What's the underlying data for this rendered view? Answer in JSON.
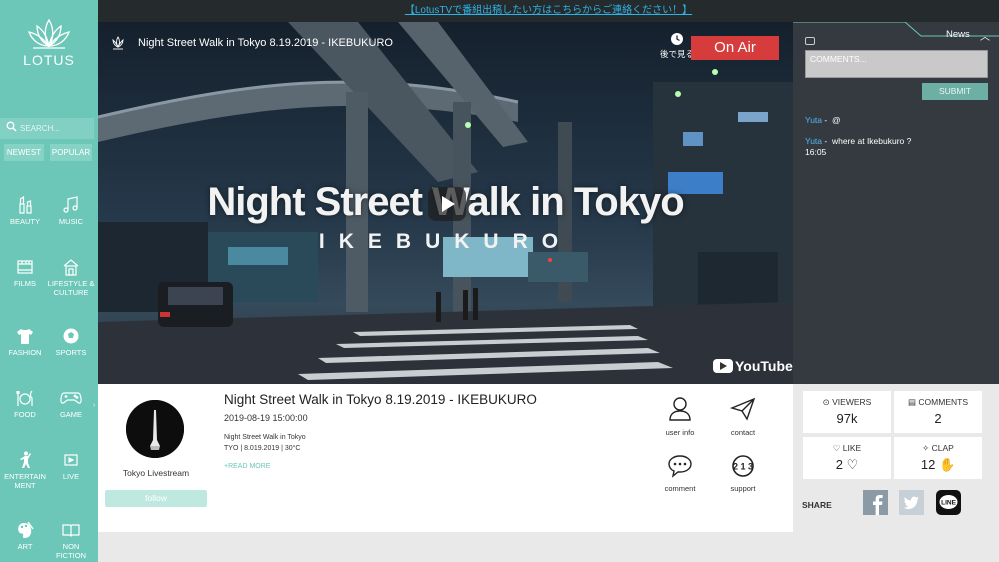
{
  "brand": {
    "name": "LOTUS"
  },
  "sidebar": {
    "search_placeholder": "SEARCH...",
    "sort": {
      "newest": "NEWEST",
      "popular": "POPULAR"
    },
    "categories": [
      {
        "label": "BEAUTY",
        "icon": "lipstick-icon"
      },
      {
        "label": "MUSIC",
        "icon": "music-note-icon"
      },
      {
        "label": "FILMS",
        "icon": "film-icon"
      },
      {
        "label": "LIFESTYLE & CULTURE",
        "icon": "house-icon"
      },
      {
        "label": "FASHION",
        "icon": "shirt-icon"
      },
      {
        "label": "SPORTS",
        "icon": "soccer-ball-icon"
      },
      {
        "label": "FOOD",
        "icon": "utensils-icon"
      },
      {
        "label": "GAME",
        "icon": "gamepad-icon"
      },
      {
        "label": "ENTERTAIN MENT",
        "icon": "performer-icon"
      },
      {
        "label": "LIVE",
        "icon": "live-icon"
      },
      {
        "label": "ART",
        "icon": "palette-icon"
      },
      {
        "label": "NON FICTION",
        "icon": "book-icon"
      }
    ]
  },
  "banner": {
    "text": "【LotusTVで番組出稿したい方はこちらからご連絡ください！】"
  },
  "video": {
    "title": "Night Street Walk in Tokyo 8.19.2019 - IKEBUKURO",
    "watch_later": "後で見る",
    "on_air": "On Air",
    "overlay_title": "Night Street Walk in Tokyo",
    "overlay_subtitle": "IKEBUKURO",
    "youtube_label": "YouTube"
  },
  "chat": {
    "tab_label": "News",
    "comment_placeholder": "COMMENTS...",
    "submit_label": "SUBMIT",
    "messages": [
      {
        "user": "Yuta",
        "sep": "-",
        "text": "@",
        "time": ""
      },
      {
        "user": "Yuta",
        "sep": "-",
        "text": "where at Ikebukuro ?",
        "time": "16:05"
      }
    ]
  },
  "info": {
    "channel_name": "Tokyo Livestream",
    "follow_label": "follow",
    "title": "Night Street Walk in Tokyo 8.19.2019 - IKEBUKURO",
    "datetime": "2019-08-19 15:00:00",
    "desc_line1": "Night Street Walk in Tokyo",
    "desc_line2": "TYO | 8.019.2019 | 30°C",
    "read_more": "+READ MORE",
    "actions": {
      "user_info": "user info",
      "contact": "contact",
      "comment": "comment",
      "support": "support"
    }
  },
  "stats": {
    "viewers_label": "VIEWERS",
    "viewers_value": "97k",
    "comments_label": "COMMENTS",
    "comments_value": "2",
    "like_label": "LIKE",
    "like_value": "2",
    "clap_label": "CLAP",
    "clap_value": "12",
    "share_label": "SHARE"
  },
  "colors": {
    "sidebar": "#6cc7b8",
    "banner_link": "#2fb3e8",
    "on_air": "#d63c3c",
    "chat_bg": "#343a40",
    "chat_user": "#55b7ef"
  }
}
